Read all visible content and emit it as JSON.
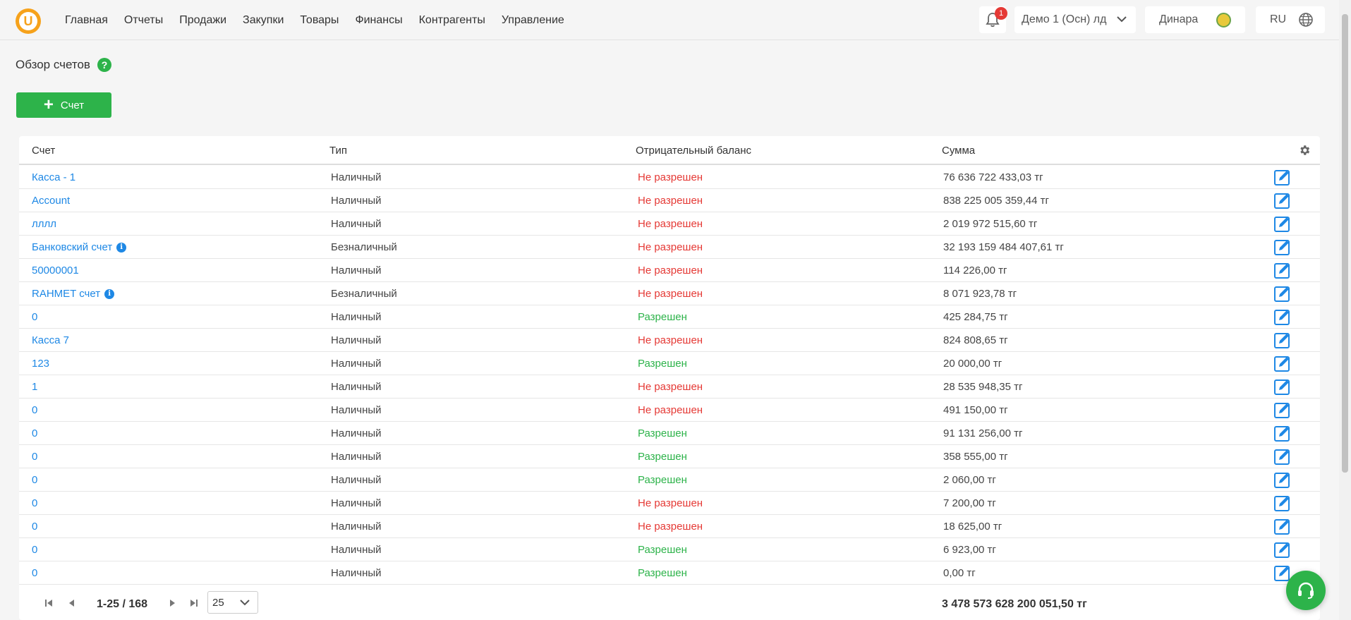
{
  "nav": {
    "items": [
      "Главная",
      "Отчеты",
      "Продажи",
      "Закупки",
      "Товары",
      "Финансы",
      "Контрагенты",
      "Управление"
    ],
    "notifications_count": "1",
    "company": "Демо 1 (Осн) лд",
    "user": "Динара",
    "lang": "RU"
  },
  "page": {
    "title": "Обзор счетов",
    "add_button": "Счет"
  },
  "table": {
    "headers": {
      "account": "Счет",
      "type": "Тип",
      "negative": "Отрицательный баланс",
      "sum": "Сумма"
    },
    "rows": [
      {
        "name": "Касса - 1",
        "type": "Наличный",
        "negative": "Не разрешен",
        "allowed": false,
        "sum": "76 636 722 433,03 тг",
        "info": false
      },
      {
        "name": "Account",
        "type": "Наличный",
        "negative": "Не разрешен",
        "allowed": false,
        "sum": "838 225 005 359,44 тг",
        "info": false
      },
      {
        "name": "лллл",
        "type": "Наличный",
        "negative": "Не разрешен",
        "allowed": false,
        "sum": "2 019 972 515,60 тг",
        "info": false
      },
      {
        "name": "Банковский счет",
        "type": "Безналичный",
        "negative": "Не разрешен",
        "allowed": false,
        "sum": "32 193 159 484 407,61 тг",
        "info": true
      },
      {
        "name": "50000001",
        "type": "Наличный",
        "negative": "Не разрешен",
        "allowed": false,
        "sum": "114 226,00 тг",
        "info": false
      },
      {
        "name": "RAHMET счет",
        "type": "Безналичный",
        "negative": "Не разрешен",
        "allowed": false,
        "sum": "8 071 923,78 тг",
        "info": true
      },
      {
        "name": "0",
        "type": "Наличный",
        "negative": "Разрешен",
        "allowed": true,
        "sum": "425 284,75 тг",
        "info": false
      },
      {
        "name": "Касса 7",
        "type": "Наличный",
        "negative": "Не разрешен",
        "allowed": false,
        "sum": "824 808,65 тг",
        "info": false
      },
      {
        "name": "123",
        "type": "Наличный",
        "negative": "Разрешен",
        "allowed": true,
        "sum": "20 000,00 тг",
        "info": false
      },
      {
        "name": "1",
        "type": "Наличный",
        "negative": "Не разрешен",
        "allowed": false,
        "sum": "28 535 948,35 тг",
        "info": false
      },
      {
        "name": "0",
        "type": "Наличный",
        "negative": "Не разрешен",
        "allowed": false,
        "sum": "491 150,00 тг",
        "info": false
      },
      {
        "name": "0",
        "type": "Наличный",
        "negative": "Разрешен",
        "allowed": true,
        "sum": "91 131 256,00 тг",
        "info": false
      },
      {
        "name": "0",
        "type": "Наличный",
        "negative": "Разрешен",
        "allowed": true,
        "sum": "358 555,00 тг",
        "info": false
      },
      {
        "name": "0",
        "type": "Наличный",
        "negative": "Разрешен",
        "allowed": true,
        "sum": "2 060,00 тг",
        "info": false
      },
      {
        "name": "0",
        "type": "Наличный",
        "negative": "Не разрешен",
        "allowed": false,
        "sum": "7 200,00 тг",
        "info": false
      },
      {
        "name": "0",
        "type": "Наличный",
        "negative": "Не разрешен",
        "allowed": false,
        "sum": "18 625,00 тг",
        "info": false
      },
      {
        "name": "0",
        "type": "Наличный",
        "negative": "Разрешен",
        "allowed": true,
        "sum": "6 923,00 тг",
        "info": false
      },
      {
        "name": "0",
        "type": "Наличный",
        "negative": "Разрешен",
        "allowed": true,
        "sum": "0,00 тг",
        "info": false
      }
    ]
  },
  "pagination": {
    "range": "1-25 / 168",
    "per_page": "25",
    "total": "3 478 573 628 200 051,50 тг"
  },
  "colors": {
    "accent": "#2db34a",
    "link": "#1e88e5",
    "danger": "#e53935",
    "brand": "#f6a21b"
  }
}
